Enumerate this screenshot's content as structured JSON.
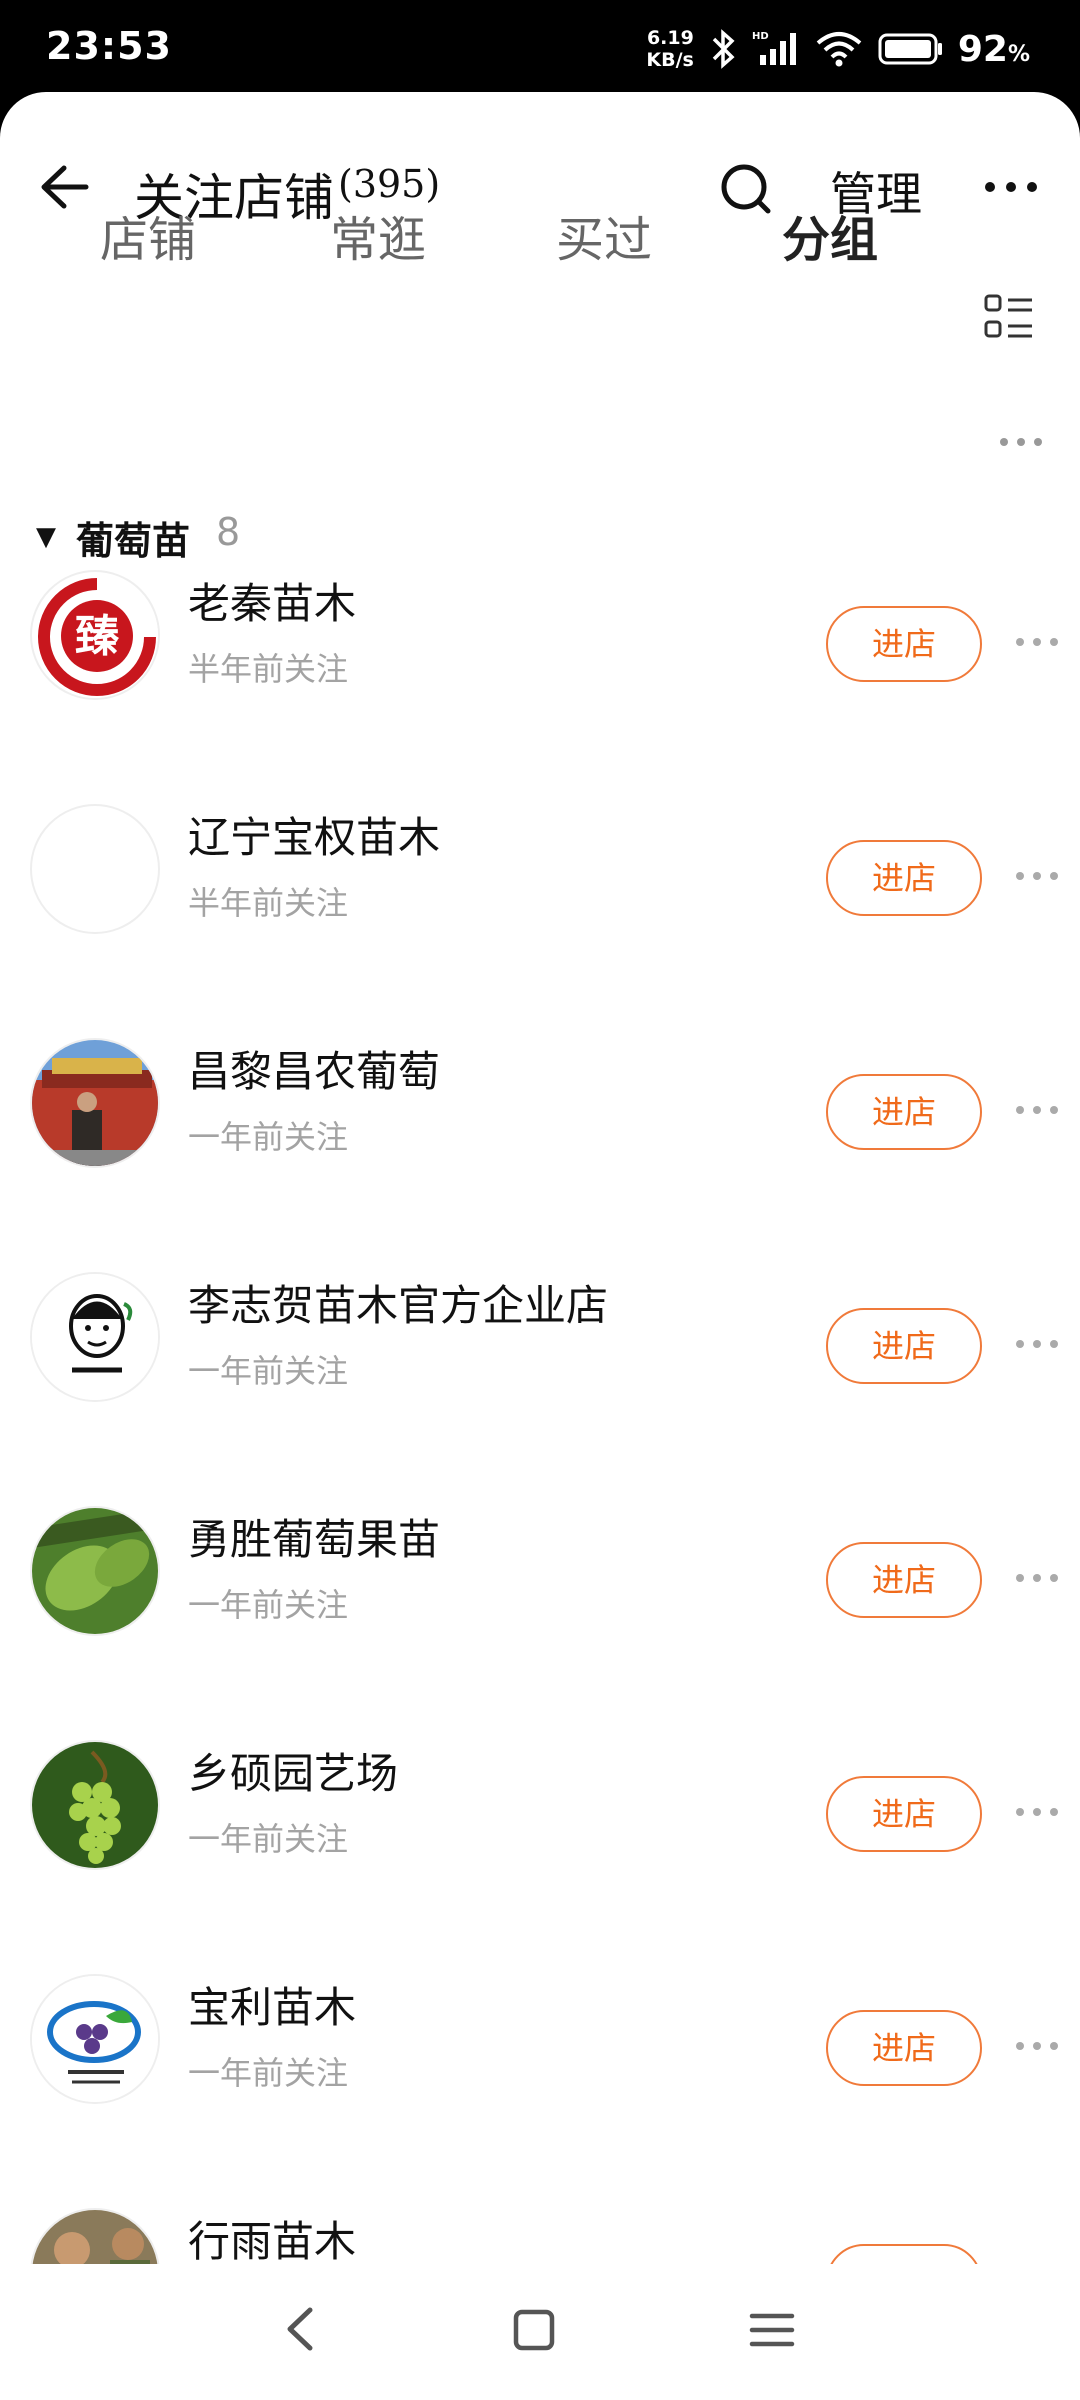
{
  "status": {
    "time": "23:53",
    "speed_value": "6.19",
    "speed_unit": "KB/s",
    "battery": "92",
    "battery_unit": "%"
  },
  "header": {
    "title": "关注店铺",
    "count": "(395)",
    "manage": "管理"
  },
  "tabs": [
    {
      "label": "店铺"
    },
    {
      "label": "常逛"
    },
    {
      "label": "买过"
    },
    {
      "label": "分组"
    }
  ],
  "group": {
    "name": "葡萄苗",
    "count": "8"
  },
  "enter_label": "进店",
  "shops": [
    {
      "name": "老秦苗木",
      "followed": "半年前关注"
    },
    {
      "name": "辽宁宝权苗木",
      "followed": "半年前关注"
    },
    {
      "name": "昌黎昌农葡萄",
      "followed": "一年前关注"
    },
    {
      "name": "李志贺苗木官方企业店",
      "followed": "一年前关注"
    },
    {
      "name": "勇胜葡萄果苗",
      "followed": "一年前关注"
    },
    {
      "name": "乡硕园艺场",
      "followed": "一年前关注"
    },
    {
      "name": "宝利苗木",
      "followed": "一年前关注"
    },
    {
      "name": "行雨苗木",
      "followed": ""
    }
  ],
  "colors": {
    "accent": "#f06a1a",
    "muted": "#a3a3a3"
  }
}
